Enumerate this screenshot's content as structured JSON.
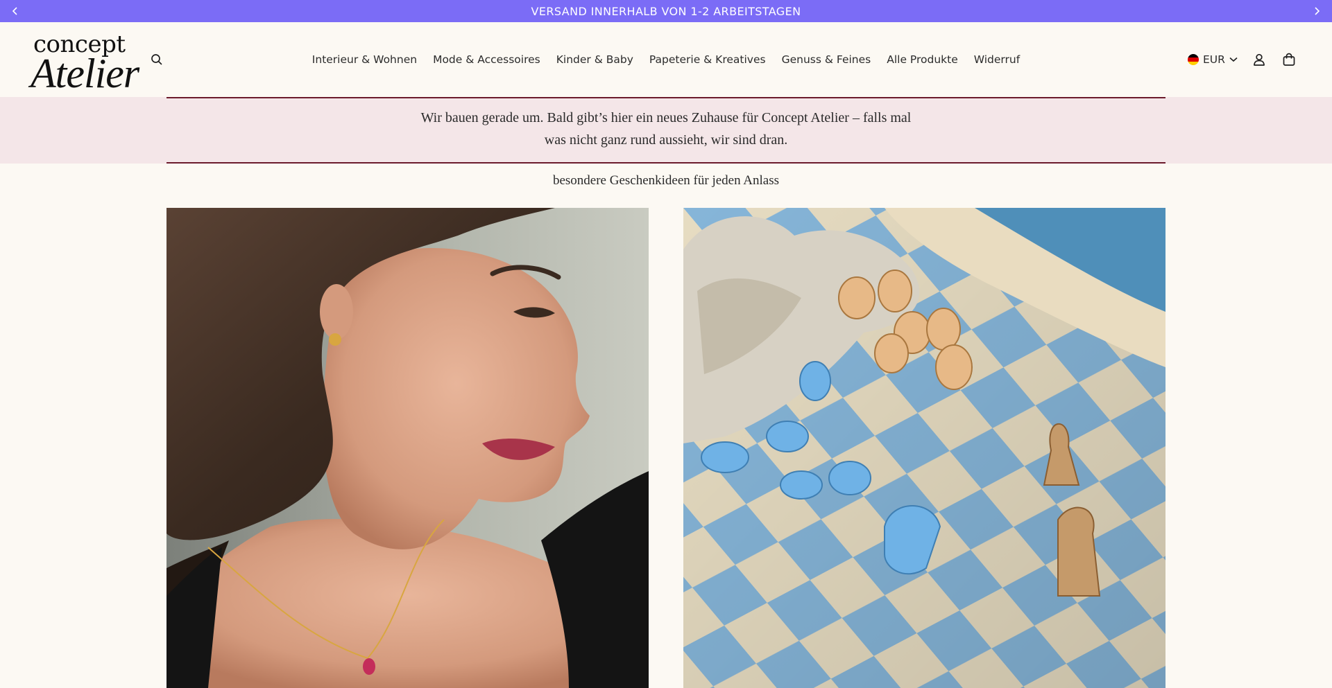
{
  "announcement": {
    "text": "VERSAND INNERHALB VON 1-2 ARBEITSTAGEN",
    "prev_icon": "chevron-left-icon",
    "next_icon": "chevron-right-icon"
  },
  "header": {
    "logo_line1": "concept",
    "logo_line2": "Atelier",
    "search_icon": "search-icon",
    "nav": [
      {
        "label": "Interieur & Wohnen"
      },
      {
        "label": "Mode & Accessoires"
      },
      {
        "label": "Kinder & Baby"
      },
      {
        "label": "Papeterie & Kreatives"
      },
      {
        "label": "Genuss & Feines"
      },
      {
        "label": "Alle Produkte"
      },
      {
        "label": "Widerruf"
      }
    ],
    "currency": "EUR",
    "account_icon": "user-icon",
    "cart_icon": "shopping-bag-icon"
  },
  "notice": {
    "line1": "Wir bauen gerade um. Bald gibt’s hier ein neues Zuhause für Concept Atelier – falls mal",
    "line2": "was nicht ganz rund aussieht, wir sind dran."
  },
  "section": {
    "subtitle": "besondere Geschenkideen für jeden Anlass"
  },
  "colors": {
    "announcement_bg": "#7b6cf6",
    "page_bg": "#fcf9f3",
    "notice_bg": "#f4e6e8",
    "notice_border": "#6b1a2b"
  }
}
